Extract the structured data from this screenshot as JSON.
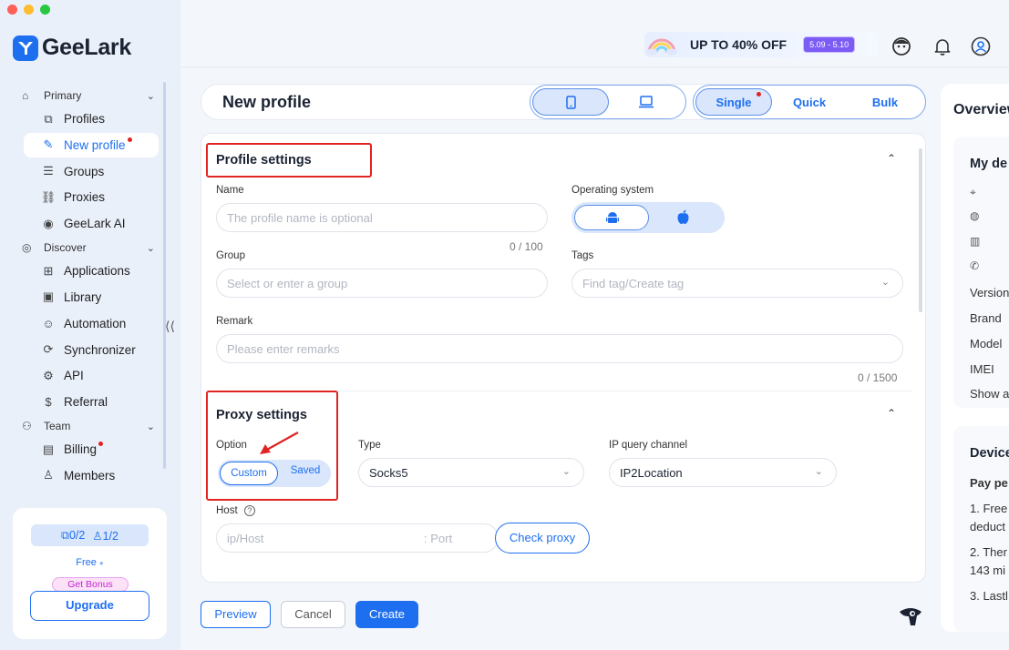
{
  "app": {
    "name": "GeeLark"
  },
  "sidebar": {
    "groups": [
      {
        "label": "Primary",
        "items": [
          {
            "label": "Profiles"
          },
          {
            "label": "New profile"
          },
          {
            "label": "Groups"
          },
          {
            "label": "Proxies"
          },
          {
            "label": "GeeLark AI"
          }
        ]
      },
      {
        "label": "Discover",
        "items": [
          {
            "label": "Applications"
          },
          {
            "label": "Library"
          },
          {
            "label": "Automation"
          },
          {
            "label": "Synchronizer"
          },
          {
            "label": "API"
          },
          {
            "label": "Referral"
          }
        ]
      },
      {
        "label": "Team",
        "items": [
          {
            "label": "Billing"
          },
          {
            "label": "Members"
          }
        ]
      }
    ],
    "plan": {
      "profiles_quota": "0/2",
      "members_quota": "1/2",
      "tier": "Free",
      "bonus_label": "Get Bonus",
      "upgrade_label": "Upgrade"
    }
  },
  "topbar": {
    "promo_text": "UP TO 40% OFF",
    "promo_dates": "5.09 - 5.10"
  },
  "header": {
    "title": "New profile",
    "modes": [
      "Single",
      "Quick",
      "Bulk"
    ],
    "selected_mode": "Single"
  },
  "profile_settings": {
    "title": "Profile settings",
    "name_label": "Name",
    "name_placeholder": "The profile name is optional",
    "name_counter": "0 / 100",
    "os_label": "Operating system",
    "group_label": "Group",
    "group_placeholder": "Select or enter a group",
    "tags_label": "Tags",
    "tags_placeholder": "Find tag/Create tag",
    "remark_label": "Remark",
    "remark_placeholder": "Please enter remarks",
    "remark_counter": "0 / 1500"
  },
  "proxy_settings": {
    "title": "Proxy settings",
    "option_label": "Option",
    "options": [
      "Custom",
      "Saved"
    ],
    "type_label": "Type",
    "type_value": "Socks5",
    "ip_channel_label": "IP query channel",
    "ip_channel_value": "IP2Location",
    "host_label": "Host",
    "host_placeholder": "ip/Host",
    "port_placeholder": ": Port",
    "check_label": "Check proxy"
  },
  "footer": {
    "preview": "Preview",
    "cancel": "Cancel",
    "create": "Create"
  },
  "overview": {
    "title": "Overview",
    "device_card_title": "My de",
    "device_fields": [
      "Version",
      "Brand",
      "Model",
      "IMEI",
      "Show a"
    ],
    "billing_card_title": "Device",
    "billing_lines": [
      "Pay pe",
      "1. Free",
      "deduct",
      "2. Ther",
      "143 mi",
      "3. Lastl"
    ]
  },
  "colors": {
    "accent": "#1e6ff0",
    "highlight": "#e02424"
  }
}
